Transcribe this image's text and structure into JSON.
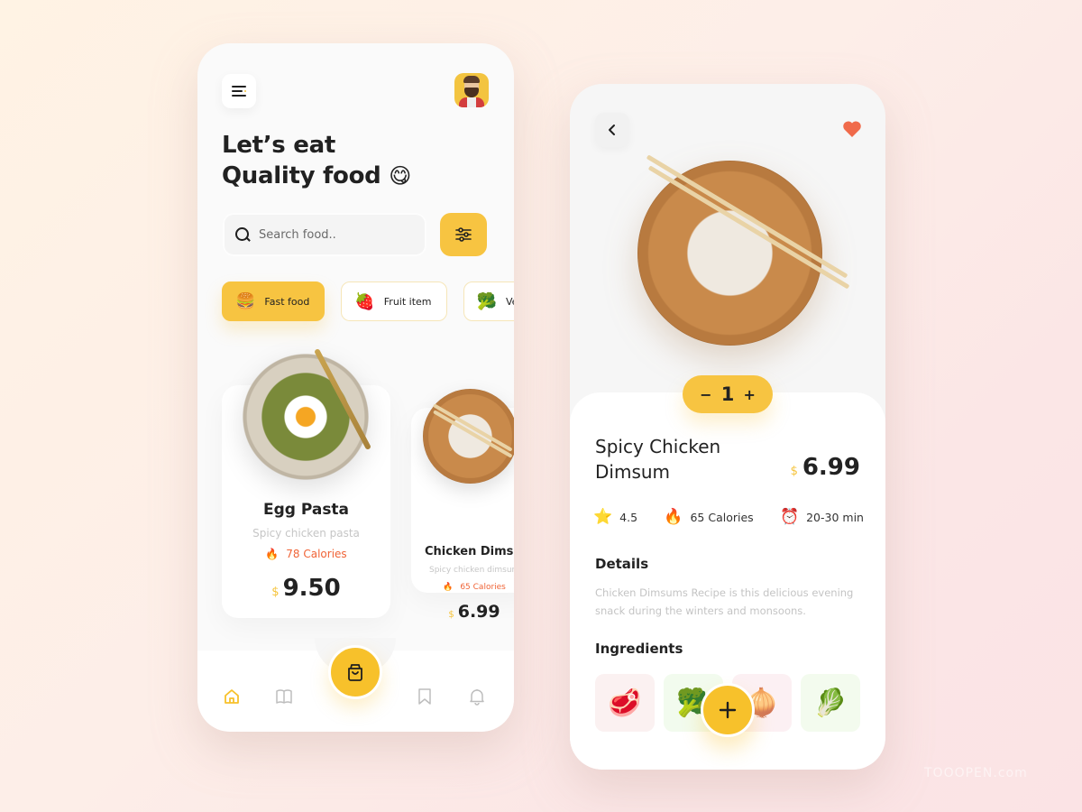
{
  "colors": {
    "accent_yellow": "#F7C441",
    "calorie_orange": "#F06437",
    "heart_red": "#F06A4A",
    "text_dark": "#222222",
    "text_muted": "#C4C4C4"
  },
  "home": {
    "menu_icon": "hamburger-menu-icon",
    "avatar": "bearded-man-avatar",
    "headline_line1": "Let’s eat",
    "headline_line2": "Quality food",
    "headline_emoji": "😋",
    "search": {
      "placeholder": "Search food..",
      "value": ""
    },
    "filter_icon": "sliders-icon",
    "categories": [
      {
        "label": "Fast food",
        "emoji": "🍔",
        "active": true
      },
      {
        "label": "Fruit item",
        "emoji": "🍓",
        "active": false
      },
      {
        "label": "Vegetable",
        "emoji": "🥦",
        "active": false
      }
    ],
    "foods": [
      {
        "name": "Egg Pasta",
        "subtitle": "Spicy chicken pasta",
        "calories": "78 Calories",
        "currency": "$",
        "price": "9.50"
      },
      {
        "name": "Chicken Dimsum",
        "subtitle": "Spicy chicken dimsum",
        "calories": "65 Calories",
        "currency": "$",
        "price": "6.99"
      }
    ],
    "nav": [
      {
        "name": "home",
        "icon": "home-icon",
        "active": true
      },
      {
        "name": "menu",
        "icon": "open-book-icon",
        "active": false
      },
      {
        "name": "cart",
        "icon": "shopping-bag-icon",
        "active": false
      },
      {
        "name": "saved",
        "icon": "bookmark-icon",
        "active": false
      },
      {
        "name": "notifications",
        "icon": "bell-icon",
        "active": false
      }
    ]
  },
  "detail": {
    "back_icon": "chevron-left-icon",
    "favorite_icon": "heart-icon",
    "quantity": "1",
    "minus_label": "−",
    "plus_label": "+",
    "name_line1": "Spicy Chicken",
    "name_line2": "Dimsum",
    "currency": "$",
    "price": "6.99",
    "stats": [
      {
        "emoji": "⭐",
        "label": "4.5"
      },
      {
        "emoji": "🔥",
        "label": "65 Calories"
      },
      {
        "emoji": "⏰",
        "label": "20-30 min"
      }
    ],
    "details_title": "Details",
    "details_text": "Chicken Dimsums Recipe is this delicious evening snack during the winters and monsoons.",
    "ingredients_title": "Ingredients",
    "ingredients": [
      {
        "name": "meat",
        "emoji": "🥩",
        "bg": "#FBF1F1"
      },
      {
        "name": "broccoli",
        "emoji": "🥦",
        "bg": "#F2FBEE"
      },
      {
        "name": "onion",
        "emoji": "🧅",
        "bg": "#FCF0F3"
      },
      {
        "name": "cabbage",
        "emoji": "🥬",
        "bg": "#F3FBEE"
      }
    ],
    "add_label": "+"
  },
  "watermark": "TOOOPEN.com"
}
